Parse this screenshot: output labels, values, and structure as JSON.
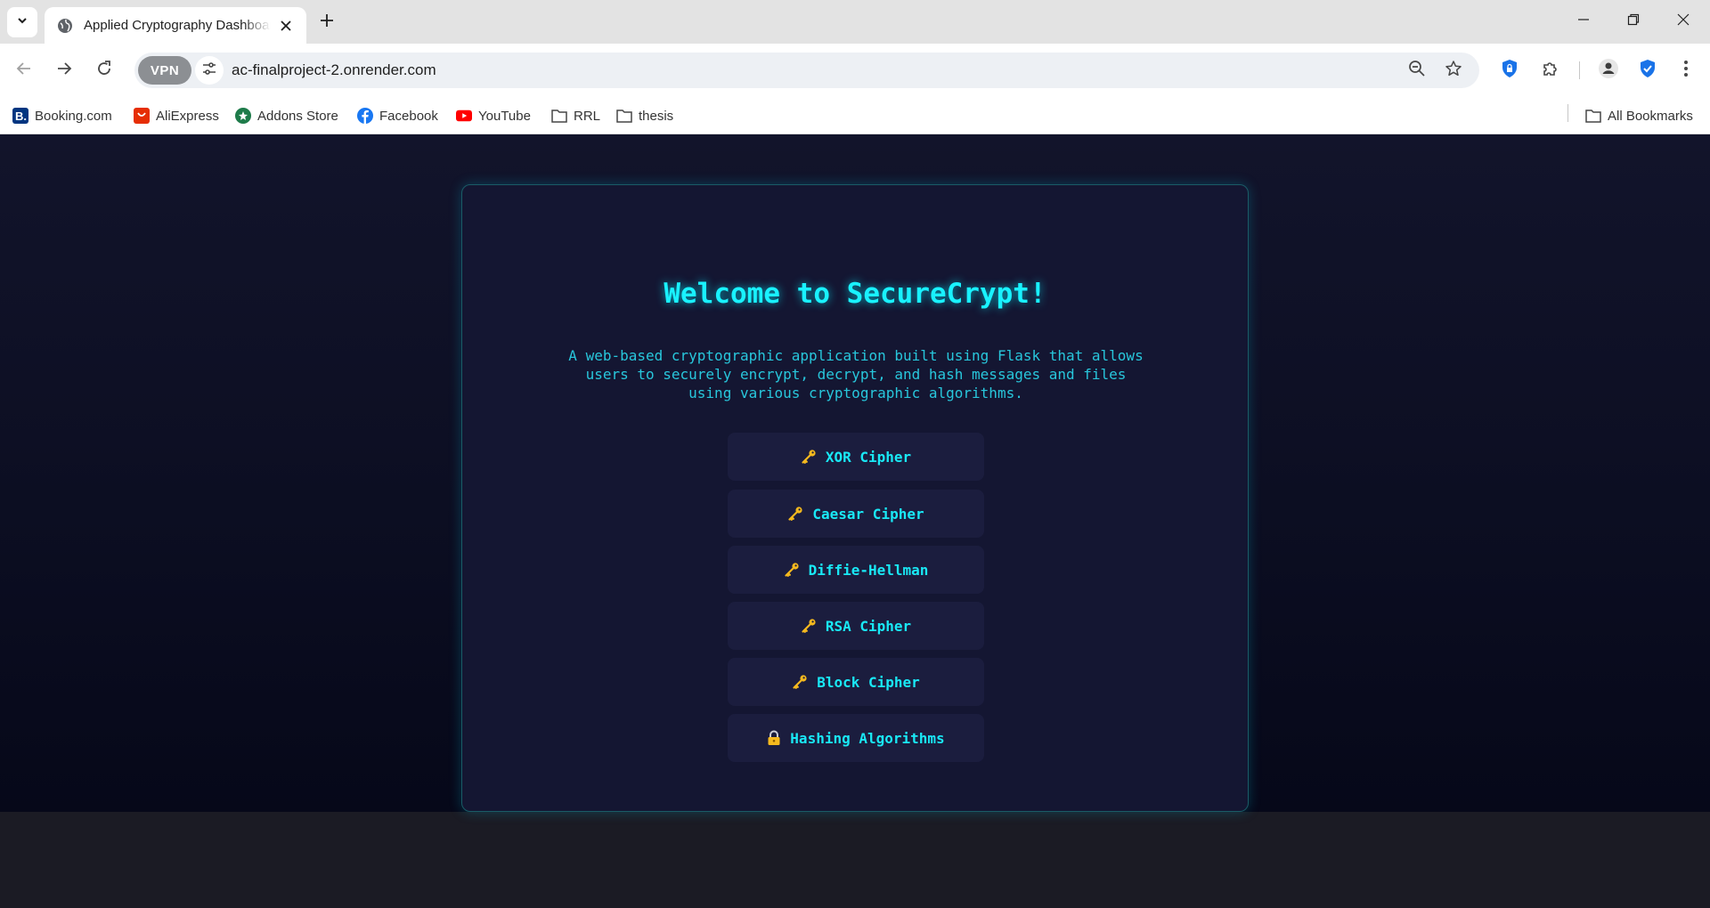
{
  "browser": {
    "tab": {
      "title": "Applied Cryptography Dashboard"
    },
    "address": {
      "url": "ac-finalproject-2.onrender.com",
      "vpn_label": "VPN"
    },
    "bookmarks": [
      {
        "label": "Booking.com",
        "icon": "booking-icon"
      },
      {
        "label": "AliExpress",
        "icon": "aliexpress-icon"
      },
      {
        "label": "Addons Store",
        "icon": "addons-store-icon"
      },
      {
        "label": "Facebook",
        "icon": "facebook-icon"
      },
      {
        "label": "YouTube",
        "icon": "youtube-icon"
      },
      {
        "label": "RRL",
        "icon": "folder-icon"
      },
      {
        "label": "thesis",
        "icon": "folder-icon"
      }
    ],
    "all_bookmarks_label": "All Bookmarks"
  },
  "page": {
    "heading": "Welcome to SecureCrypt!",
    "description": "A web-based cryptographic application built using Flask that allows users to securely encrypt, decrypt, and hash messages and files using various cryptographic algorithms.",
    "menu": [
      {
        "label": "XOR Cipher",
        "icon": "key-icon"
      },
      {
        "label": "Caesar Cipher",
        "icon": "key-icon"
      },
      {
        "label": "Diffie-Hellman",
        "icon": "key-icon"
      },
      {
        "label": "RSA Cipher",
        "icon": "key-icon"
      },
      {
        "label": "Block Cipher",
        "icon": "key-icon"
      },
      {
        "label": "Hashing Algorithms",
        "icon": "lock-icon"
      }
    ]
  },
  "colors": {
    "accent": "#19f2ff",
    "background": "#0c0e22",
    "card": "#141632",
    "button": "#1b1d3e"
  }
}
